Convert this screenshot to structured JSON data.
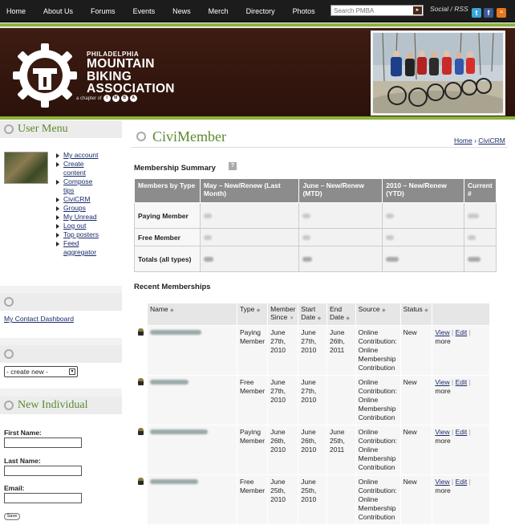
{
  "nav": {
    "items": [
      "Home",
      "About Us",
      "Forums",
      "Events",
      "News",
      "Merch",
      "Directory",
      "Photos"
    ],
    "search_placeholder": "Search PMBA",
    "social_label": "Social / RSS",
    "social_icons": [
      "twitter-icon",
      "facebook-icon",
      "rss-icon"
    ]
  },
  "header": {
    "logo_line1": "PHILADELPHIA",
    "logo_line2": "MOUNTAIN",
    "logo_line3": "BIKING",
    "logo_line4": "ASSOCIATION",
    "chapter_text": "a chapter of",
    "chapter_letters": [
      "I",
      "M",
      "B",
      "A"
    ]
  },
  "sidebar": {
    "user_menu_title": "User Menu",
    "user_menu_items": [
      "My account",
      "Create",
      "content",
      "Compose",
      "tips",
      "CiviCRM",
      "Groups",
      "My Unread",
      "Log out",
      "Top posters",
      "Feed",
      "aggregator"
    ],
    "contact_dashboard": "My Contact Dashboard",
    "create_select": "- create new -",
    "new_individual_title": "New Individual",
    "first_name_label": "First Name:",
    "last_name_label": "Last Name:",
    "email_label": "Email:",
    "save_label": "Save"
  },
  "main": {
    "title": "CiviMember",
    "breadcrumb_home": "Home",
    "breadcrumb_sep": "›",
    "breadcrumb_civi": "CiviCRM",
    "summary_title": "Membership Summary",
    "summary_headers": [
      "Members by Type",
      "May – New/Renew (Last Month)",
      "June – New/Renew (MTD)",
      "2010 – New/Renew (YTD)",
      "Current #"
    ],
    "summary_rows": [
      "Paying Member",
      "Free Member",
      "Totals (all types)"
    ],
    "recent_title": "Recent Memberships",
    "recent_headers": [
      "Name",
      "Type",
      "Member Since",
      "Start Date",
      "End Date",
      "Source",
      "Status"
    ],
    "recent_rows": [
      {
        "type": "Paying Member",
        "since": "June 27th, 2010",
        "start": "June 27th, 2010",
        "end": "June 26th, 2011",
        "source": "Online Contribution: Online Membership Contribution",
        "status": "New"
      },
      {
        "type": "Free Member",
        "since": "June 27th, 2010",
        "start": "June 27th, 2010",
        "end": "",
        "source": "Online Contribution: Online Membership Contribution",
        "status": "New"
      },
      {
        "type": "Paying Member",
        "since": "June 26th, 2010",
        "start": "June 26th, 2010",
        "end": "June 25th, 2011",
        "source": "Online Contribution: Online Membership Contribution",
        "status": "New"
      },
      {
        "type": "Free Member",
        "since": "June 25th, 2010",
        "start": "June 25th, 2010",
        "end": "",
        "source": "Online Contribution: Online Membership Contribution",
        "status": "New"
      }
    ],
    "row_actions": {
      "view": "View",
      "edit": "Edit",
      "more": "more"
    }
  },
  "colors": {
    "nav_bg": "#1c1c1c",
    "header_bg": "#2b120b",
    "accent_green": "#8db33a",
    "title_green": "#5a8a2e",
    "table_header": "#8c8c8c",
    "link": "#1a2b6a"
  }
}
